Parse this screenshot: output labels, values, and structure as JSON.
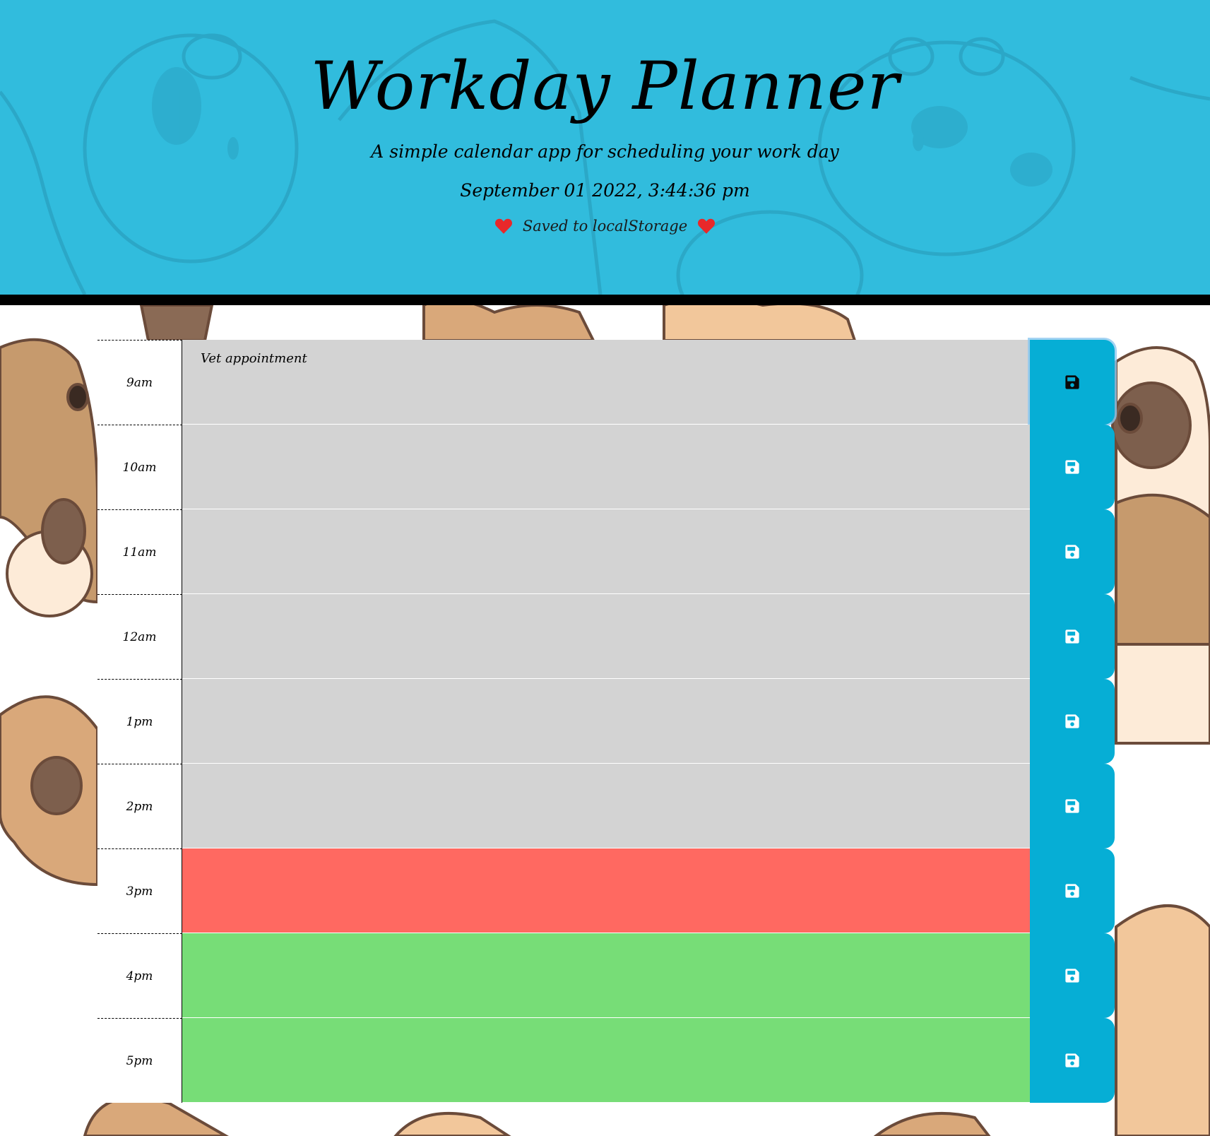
{
  "header": {
    "title": "Workday Planner",
    "subtitle": "A simple calendar app for scheduling your work day",
    "datetime": "September 01 2022, 3:44:36 pm",
    "saved_notice": "Saved to localStorage",
    "background_color": "#31bcdd",
    "heart_icon": "heart-icon",
    "heart_color": "#e8282a"
  },
  "planner": {
    "save_icon": "floppy-disk-icon",
    "colors": {
      "past": "#d3d3d3",
      "present": "#ff6961",
      "future": "#77dd77",
      "save_button": "#06aed5"
    },
    "rows": [
      {
        "hour": "9am",
        "text": "Vet appointment",
        "status": "past"
      },
      {
        "hour": "10am",
        "text": "",
        "status": "past"
      },
      {
        "hour": "11am",
        "text": "",
        "status": "past"
      },
      {
        "hour": "12am",
        "text": "",
        "status": "past"
      },
      {
        "hour": "1pm",
        "text": "",
        "status": "past"
      },
      {
        "hour": "2pm",
        "text": "",
        "status": "past"
      },
      {
        "hour": "3pm",
        "text": "",
        "status": "present"
      },
      {
        "hour": "4pm",
        "text": "",
        "status": "future"
      },
      {
        "hour": "5pm",
        "text": "",
        "status": "future"
      }
    ]
  }
}
